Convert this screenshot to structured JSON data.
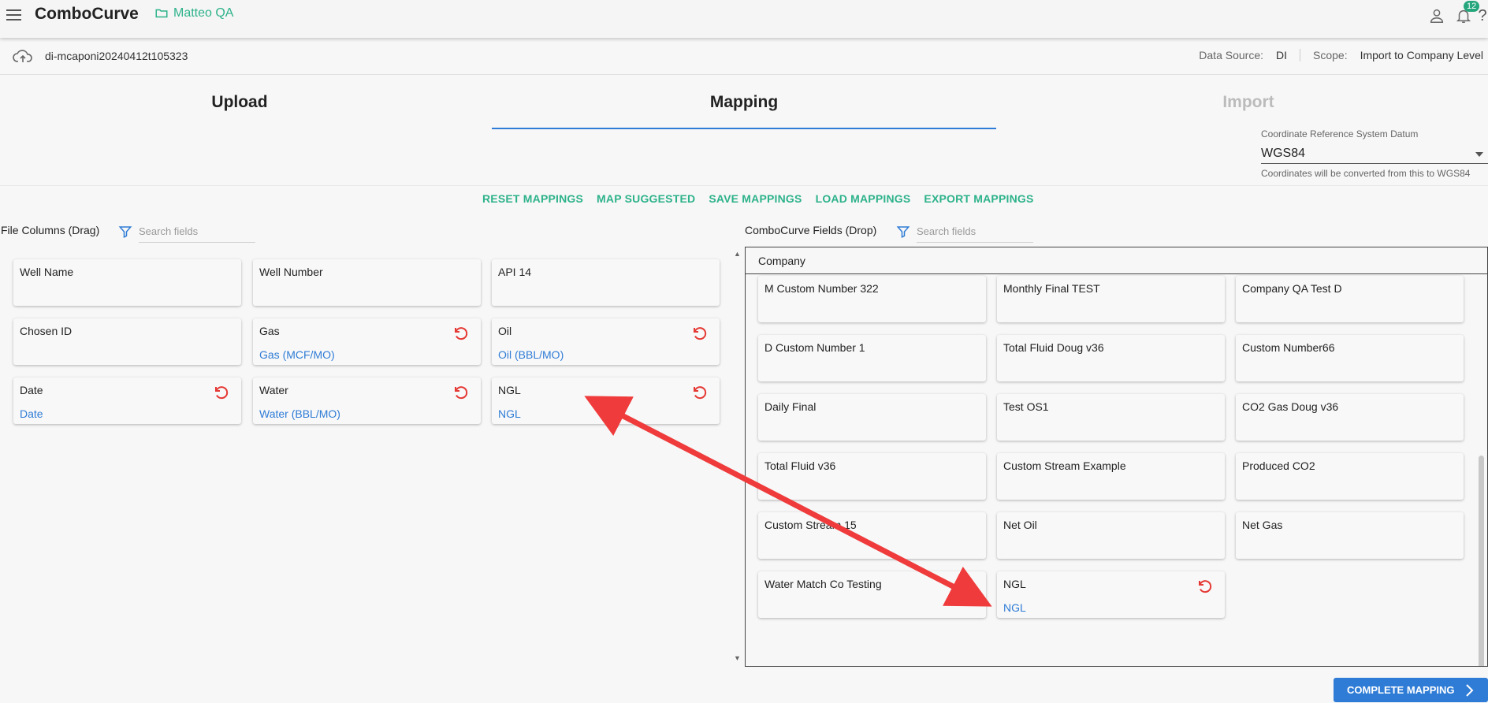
{
  "app": {
    "brand": "ComboCurve",
    "project": "Matteo QA",
    "notifications": "12"
  },
  "import": {
    "name": "di-mcaponi20240412t105323",
    "data_source_label": "Data Source:",
    "data_source": "DI",
    "scope_label": "Scope:",
    "scope": "Import to Company Level"
  },
  "steps": {
    "upload": "Upload",
    "mapping": "Mapping",
    "import": "Import"
  },
  "crs": {
    "label": "Coordinate Reference System Datum",
    "value": "WGS84",
    "help": "Coordinates will be converted from this to WGS84"
  },
  "actions": {
    "reset": "RESET MAPPINGS",
    "suggested": "MAP SUGGESTED",
    "save": "SAVE MAPPINGS",
    "load": "LOAD MAPPINGS",
    "export": "EXPORT MAPPINGS"
  },
  "file_columns": {
    "title": "File Columns (Drag)",
    "search_placeholder": "Search fields",
    "cards": [
      {
        "name": "Well Name",
        "mapped": ""
      },
      {
        "name": "Well Number",
        "mapped": ""
      },
      {
        "name": "API 14",
        "mapped": ""
      },
      {
        "name": "Chosen ID",
        "mapped": ""
      },
      {
        "name": "Gas",
        "mapped": "Gas (MCF/MO)"
      },
      {
        "name": "Oil",
        "mapped": "Oil (BBL/MO)"
      },
      {
        "name": "Date",
        "mapped": "Date"
      },
      {
        "name": "Water",
        "mapped": "Water (BBL/MO)"
      },
      {
        "name": "NGL",
        "mapped": "NGL"
      }
    ]
  },
  "cc_fields": {
    "title": "ComboCurve Fields (Drop)",
    "search_placeholder": "Search fields",
    "group": "Company",
    "cards": [
      {
        "name": "",
        "mapped": ""
      },
      {
        "name": "",
        "mapped": ""
      },
      {
        "name": "",
        "mapped": ""
      },
      {
        "name": "M Custom Number 322",
        "mapped": ""
      },
      {
        "name": "Monthly Final TEST",
        "mapped": ""
      },
      {
        "name": "Company QA Test D",
        "mapped": ""
      },
      {
        "name": "D Custom Number 1",
        "mapped": ""
      },
      {
        "name": "Total Fluid Doug v36",
        "mapped": ""
      },
      {
        "name": "Custom Number66",
        "mapped": ""
      },
      {
        "name": "Daily Final",
        "mapped": ""
      },
      {
        "name": "Test OS1",
        "mapped": ""
      },
      {
        "name": "CO2 Gas Doug v36",
        "mapped": ""
      },
      {
        "name": "Total Fluid v36",
        "mapped": ""
      },
      {
        "name": "Custom Stream Example",
        "mapped": ""
      },
      {
        "name": "Produced CO2",
        "mapped": ""
      },
      {
        "name": "Custom Stream 15",
        "mapped": ""
      },
      {
        "name": "Net Oil",
        "mapped": ""
      },
      {
        "name": "Net Gas",
        "mapped": ""
      },
      {
        "name": "Water Match Co Testing",
        "mapped": ""
      },
      {
        "name": "NGL",
        "mapped": "NGL"
      }
    ]
  },
  "complete_button": "COMPLETE MAPPING",
  "colors": {
    "accent": "#2db28a",
    "primary": "#2f7cd6",
    "reset": "#e53935",
    "arrow": "#ef3b3b"
  }
}
